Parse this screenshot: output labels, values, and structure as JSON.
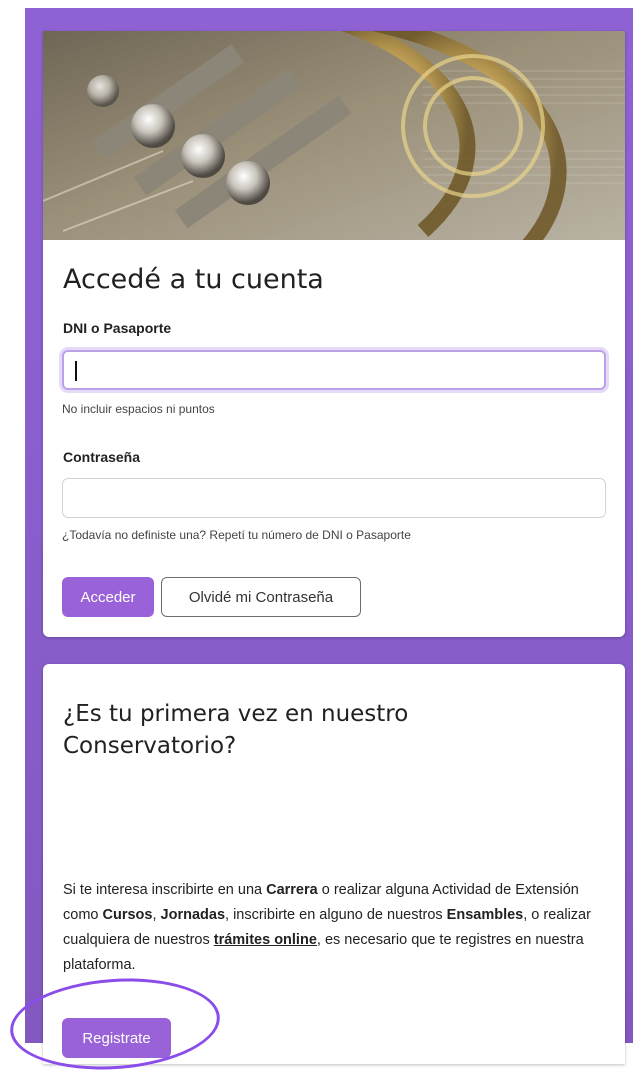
{
  "login_card": {
    "title": "Accedé a tu cuenta",
    "dni_label": "DNI o Pasaporte",
    "dni_value": "",
    "dni_help": "No incluir espacios ni puntos",
    "password_label": "Contraseña",
    "password_value": "",
    "password_help": "¿Todavía no definiste una? Repetí tu número de DNI o Pasaporte",
    "submit_label": "Acceder",
    "forgot_label": "Olvidé mi Contraseña"
  },
  "register_card": {
    "title": "¿Es tu primera vez en nuestro Conservatorio?",
    "paragraph": {
      "t1": "Si te interesa inscribirte en una ",
      "carrera": "Carrera",
      "t2": " o realizar alguna Actividad de Extensión como ",
      "cursos": "Cursos",
      "t3": ", ",
      "jornadas": "Jornadas",
      "t4": ", inscribirte en alguno de nuestros ",
      "ensambles": "Ensambles",
      "t5": ", o realizar cualquiera de nuestros ",
      "tramites": "trámites online",
      "t6": ", es necesario que te registres en nuestra plataforma."
    },
    "register_label": "Registrate"
  },
  "colors": {
    "background": "#8f62d4",
    "primary_button": "#9a62d8",
    "focus_ring": "#bca1e8",
    "highlight_circle": "#8a4dea"
  }
}
